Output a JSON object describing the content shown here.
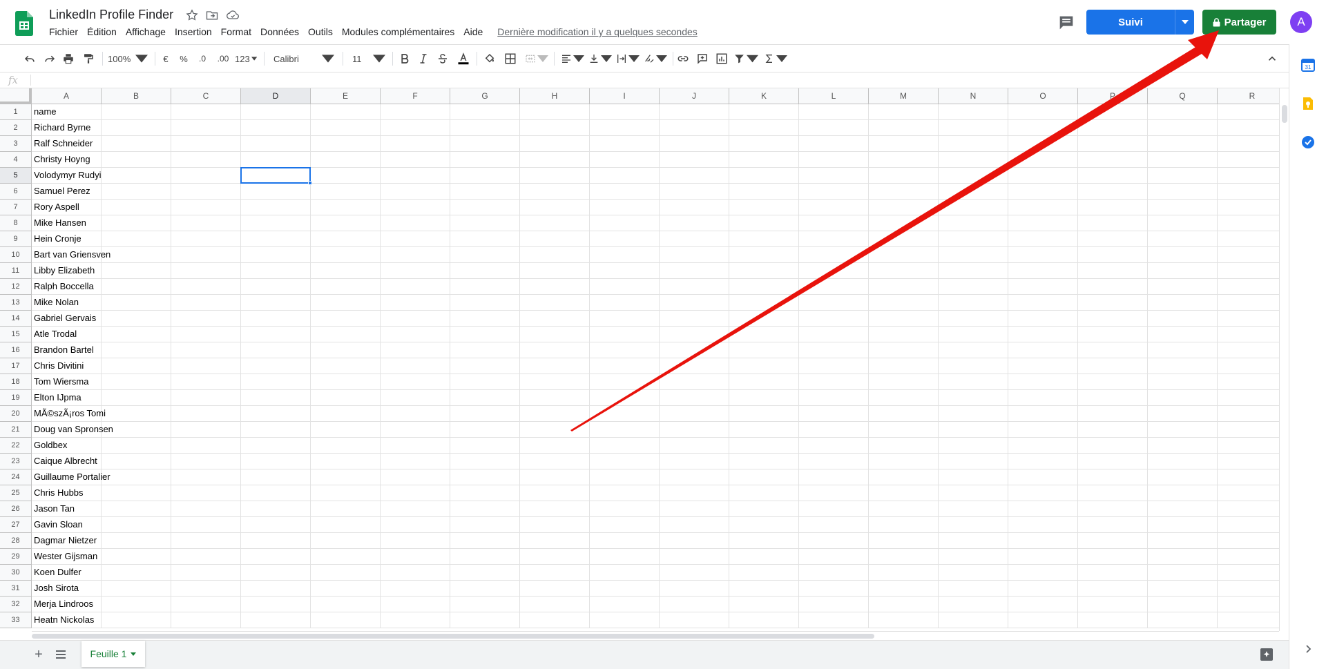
{
  "header": {
    "doc_title": "LinkedIn Profile Finder",
    "menu": [
      "Fichier",
      "Édition",
      "Affichage",
      "Insertion",
      "Format",
      "Données",
      "Outils",
      "Modules complémentaires",
      "Aide"
    ],
    "last_edit": "Dernière modification il y a quelques secondes",
    "follow_label": "Suivi",
    "share_label": "Partager",
    "avatar_letter": "A"
  },
  "toolbar": {
    "zoom": "100%",
    "currency": "€",
    "percent": "%",
    "decimal_decrease": ".0",
    "decimal_increase": ".00",
    "more_formats": "123",
    "font": "Calibri",
    "font_size": "11"
  },
  "grid": {
    "columns": [
      "A",
      "B",
      "C",
      "D",
      "E",
      "F",
      "G",
      "H",
      "I",
      "J",
      "K",
      "L",
      "M",
      "N",
      "O",
      "P",
      "Q",
      "R"
    ],
    "selected_column": "D",
    "selected_row": 5,
    "column_a_values": [
      "name",
      "Richard Byrne",
      "Ralf Schneider",
      "Christy Hoyng",
      "Volodymyr Rudyi",
      "Samuel Perez",
      "Rory Aspell",
      "Mike Hansen",
      "Hein Cronje",
      "Bart van Griensven",
      "Libby Elizabeth",
      "Ralph Boccella",
      "Mike Nolan",
      "Gabriel Gervais",
      "Atle Trodal",
      "Brandon Bartel",
      "Chris Divitini",
      "Tom Wiersma",
      "Elton IJpma",
      "MÃ©szÃ¡ros Tomi",
      "Doug van Spronsen",
      "Goldbex",
      "Caique Albrecht",
      "Guillaume Portalier",
      "Chris Hubbs",
      "Jason Tan",
      "Gavin Sloan",
      "Dagmar Nietzer",
      "Wester Gijsman",
      "Koen Dulfer",
      "Josh Sirota",
      "Merja Lindroos",
      "Heatn Nickolas"
    ]
  },
  "bottom": {
    "add_sheet": "+",
    "sheet_name": "Feuille 1"
  },
  "colors": {
    "follow": "#1a73e8",
    "share": "#188038",
    "avatar": "#7e3ff2",
    "selection": "#1a73e8",
    "arrow": "#e8130c"
  }
}
